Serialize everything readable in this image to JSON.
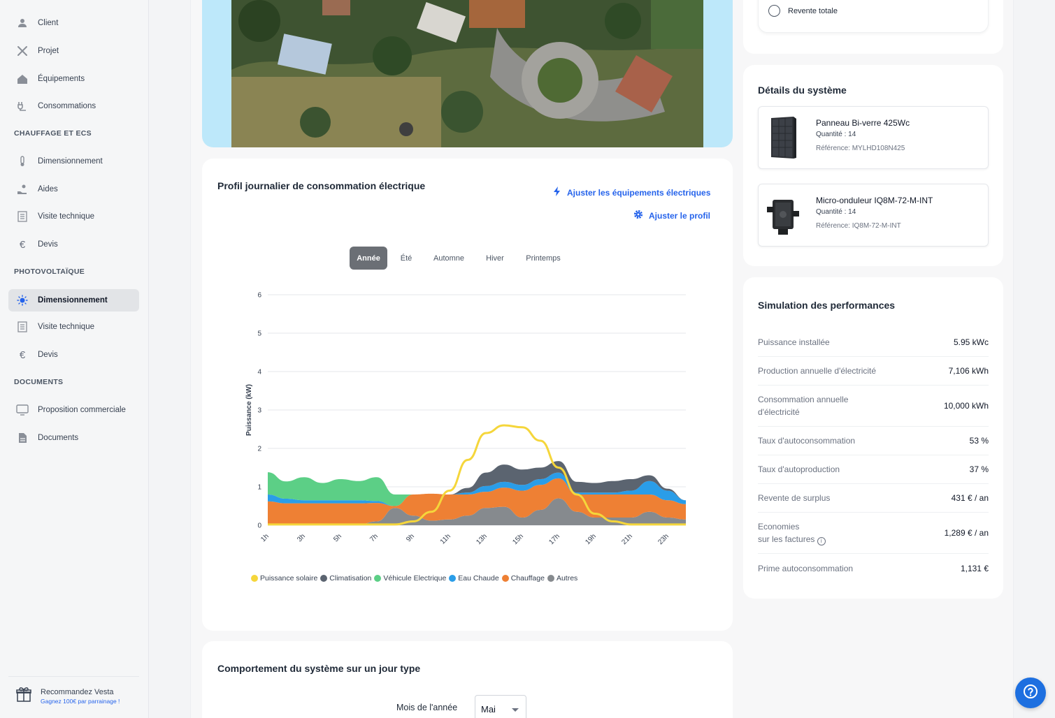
{
  "sidebar": {
    "items": [
      {
        "label": "Client",
        "icon": "user-icon"
      },
      {
        "label": "Projet",
        "icon": "tools-icon"
      },
      {
        "label": "Équipements",
        "icon": "house-icon"
      },
      {
        "label": "Consommations",
        "icon": "plug-icon"
      }
    ],
    "sections": [
      {
        "title": "CHAUFFAGE ET ECS",
        "items": [
          {
            "label": "Dimensionnement",
            "icon": "thermometer-icon"
          },
          {
            "label": "Aides",
            "icon": "hand-coin-icon"
          },
          {
            "label": "Visite technique",
            "icon": "checklist-icon"
          },
          {
            "label": "Devis",
            "icon": "euro-icon"
          }
        ]
      },
      {
        "title": "PHOTOVOLTAÏQUE",
        "items": [
          {
            "label": "Dimensionnement",
            "icon": "sun-icon",
            "active": true
          },
          {
            "label": "Visite technique",
            "icon": "checklist-icon"
          },
          {
            "label": "Devis",
            "icon": "euro-icon"
          }
        ]
      },
      {
        "title": "DOCUMENTS",
        "items": [
          {
            "label": "Proposition commerciale",
            "icon": "monitor-icon"
          },
          {
            "label": "Documents",
            "icon": "document-icon"
          }
        ]
      }
    ],
    "promo": {
      "title": "Recommandez Vesta",
      "subtitle": "Gagnez 100€ par parrainage !"
    }
  },
  "consumption": {
    "title": "Profil journalier de consommation électrique",
    "adjust_equipment": "Ajuster les équipements électriques",
    "adjust_profile": "Ajuster le profil",
    "tabs": [
      "Année",
      "Été",
      "Automne",
      "Hiver",
      "Printemps"
    ],
    "active_tab": "Année"
  },
  "chart_data": {
    "type": "area",
    "ylabel": "Puissance (kW)",
    "ylim": [
      0,
      6
    ],
    "yticks": [
      0,
      1,
      2,
      3,
      4,
      5,
      6
    ],
    "x": [
      1,
      2,
      3,
      4,
      5,
      6,
      7,
      8,
      9,
      10,
      11,
      12,
      13,
      14,
      15,
      16,
      17,
      18,
      19,
      20,
      21,
      22,
      23,
      24
    ],
    "xtick_labels": [
      "1h",
      "3h",
      "5h",
      "7h",
      "9h",
      "11h",
      "13h",
      "15h",
      "17h",
      "19h",
      "21h",
      "23h"
    ],
    "grid": true,
    "legend_position": "bottom",
    "stacked_series": [
      {
        "name": "Autres",
        "color": "#868a8e",
        "values": [
          0.02,
          0.02,
          0.02,
          0.02,
          0.02,
          0.02,
          0.1,
          0.45,
          0.25,
          0.12,
          0.15,
          0.25,
          0.45,
          0.48,
          0.2,
          0.4,
          0.7,
          0.35,
          0.2,
          0.2,
          0.2,
          0.35,
          0.2,
          0.15
        ]
      },
      {
        "name": "Chauffage",
        "color": "#ee8034",
        "values": [
          0.6,
          0.55,
          0.55,
          0.55,
          0.55,
          0.55,
          0.48,
          0.05,
          0.55,
          0.7,
          0.65,
          0.55,
          0.42,
          0.5,
          0.7,
          0.65,
          0.52,
          0.45,
          0.6,
          0.6,
          0.6,
          0.45,
          0.45,
          0.4
        ]
      },
      {
        "name": "Eau Chaude",
        "color": "#2a9de8",
        "values": [
          0.18,
          0.12,
          0.08,
          0.08,
          0.08,
          0.08,
          0.05,
          0.0,
          0.0,
          0.0,
          0.0,
          0.05,
          0.15,
          0.15,
          0.15,
          0.15,
          0.15,
          0.05,
          0.05,
          0.05,
          0.1,
          0.35,
          0.25,
          0.1
        ]
      },
      {
        "name": "Véhicule Electrique",
        "color": "#5ccf86",
        "values": [
          0.58,
          0.45,
          0.6,
          0.45,
          0.55,
          0.5,
          0.62,
          0.3,
          0.0,
          0.0,
          0.0,
          0.0,
          0.0,
          0.0,
          0.0,
          0.0,
          0.0,
          0.0,
          0.0,
          0.0,
          0.0,
          0.0,
          0.0,
          0.0
        ]
      },
      {
        "name": "Climatisation",
        "color": "#5b6470",
        "values": [
          0,
          0,
          0,
          0,
          0,
          0,
          0,
          0,
          0,
          0,
          0,
          0.12,
          0.35,
          0.45,
          0.4,
          0.3,
          0.3,
          0.28,
          0.25,
          0.3,
          0.3,
          0.15,
          0.05,
          0.0
        ]
      }
    ],
    "solar": {
      "name": "Puissance solaire",
      "color": "#f5d63b",
      "values": [
        0.02,
        0.02,
        0.02,
        0.02,
        0.02,
        0.02,
        0.02,
        0.02,
        0.1,
        0.35,
        0.9,
        1.7,
        2.4,
        2.6,
        2.55,
        2.2,
        1.5,
        0.8,
        0.3,
        0.1,
        0.02,
        0.02,
        0.02,
        0.02
      ]
    },
    "legend_order": [
      "Puissance solaire",
      "Climatisation",
      "Véhicule Electrique",
      "Eau Chaude",
      "Chauffage",
      "Autres"
    ]
  },
  "resale": {
    "option_label": "Revente totale"
  },
  "system": {
    "title": "Détails du système",
    "items": [
      {
        "name": "Panneau Bi-verre 425Wc",
        "qty": "Quantité : 14",
        "ref": "Référence: MYLHD108N425",
        "icon": "solar-panel-icon"
      },
      {
        "name": "Micro-onduleur IQ8M-72-M-INT",
        "qty": "Quantité : 14",
        "ref": "Référence: IQ8M-72-M-INT",
        "icon": "microinverter-icon"
      }
    ]
  },
  "performance": {
    "title": "Simulation des performances",
    "rows": [
      {
        "label": "Puissance installée",
        "value": "5.95 kWc"
      },
      {
        "label": "Production annuelle d'électricité",
        "value": "7,106 kWh"
      },
      {
        "label": "Consommation annuelle",
        "label2": "d'électricité",
        "value": "10,000 kWh"
      },
      {
        "label": "Taux d'autoconsommation",
        "value": "53 %"
      },
      {
        "label": "Taux d'autoproduction",
        "value": "37 %"
      },
      {
        "label": "Revente de surplus",
        "value": "431 € / an"
      },
      {
        "label": "Economies",
        "label2": "sur les factures",
        "value": "1,289 € / an"
      },
      {
        "label": "Prime autoconsommation",
        "value": "1,131 €"
      }
    ]
  },
  "behavior": {
    "title": "Comportement du système sur un jour type",
    "month_label": "Mois de l'année",
    "month_value": "Mai"
  }
}
